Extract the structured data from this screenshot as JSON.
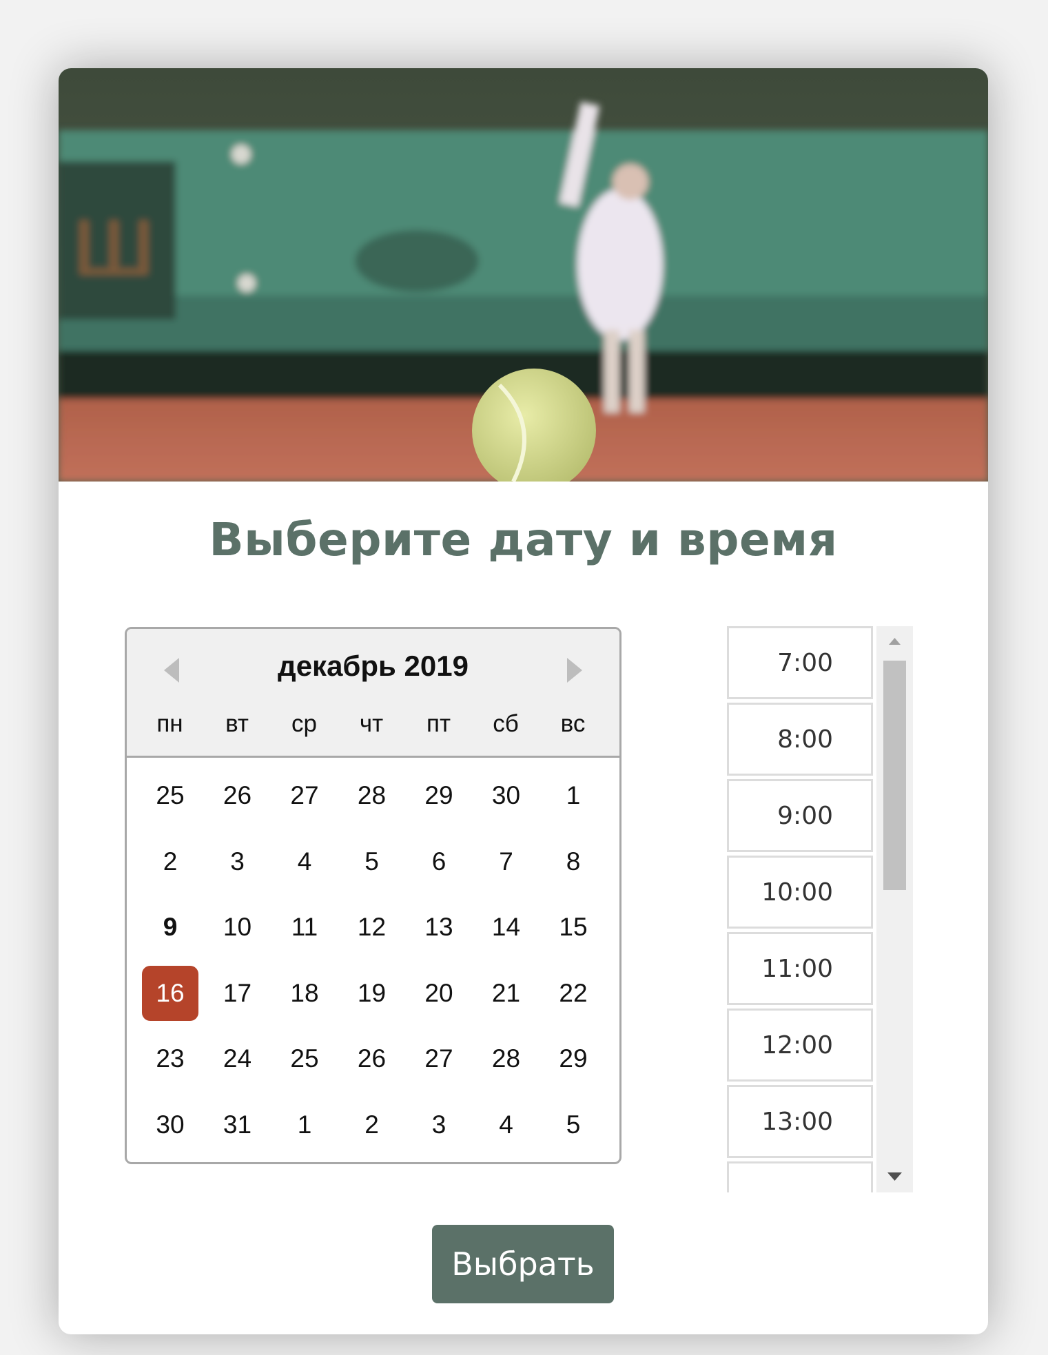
{
  "header": {
    "image_icon": "tennis-court-photo",
    "title": "Выберите дату и время"
  },
  "calendar": {
    "month_label": "декабрь 2019",
    "prev_icon": "triangle-left-icon",
    "next_icon": "triangle-right-icon",
    "weekdays": [
      "пн",
      "вт",
      "ср",
      "чт",
      "пт",
      "сб",
      "вс"
    ],
    "weeks": [
      [
        "25",
        "26",
        "27",
        "28",
        "29",
        "30",
        "1"
      ],
      [
        "2",
        "3",
        "4",
        "5",
        "6",
        "7",
        "8"
      ],
      [
        "9",
        "10",
        "11",
        "12",
        "13",
        "14",
        "15"
      ],
      [
        "16",
        "17",
        "18",
        "19",
        "20",
        "21",
        "22"
      ],
      [
        "23",
        "24",
        "25",
        "26",
        "27",
        "28",
        "29"
      ],
      [
        "30",
        "31",
        "1",
        "2",
        "3",
        "4",
        "5"
      ]
    ],
    "today": "9",
    "selected": "16",
    "selected_color": "#b5442a"
  },
  "times": {
    "slots": [
      "7:00",
      "8:00",
      "9:00",
      "10:00",
      "11:00",
      "12:00",
      "13:00"
    ],
    "scroll_up_icon": "triangle-up-icon",
    "scroll_down_icon": "triangle-down-icon"
  },
  "actions": {
    "select_label": "Выбрать"
  },
  "colors": {
    "accent": "#5b7168",
    "selected_day": "#b5442a"
  }
}
